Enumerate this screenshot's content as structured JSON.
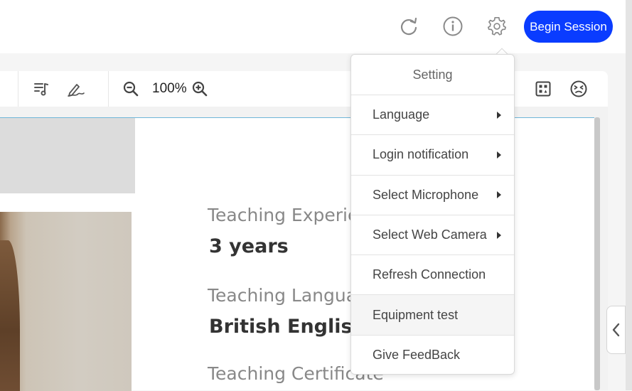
{
  "header": {
    "begin_label": "Begin Session",
    "icons": [
      "refresh-icon",
      "info-icon",
      "gear-icon"
    ]
  },
  "toolbar": {
    "zoom": "100%",
    "icons": [
      "playlist-icon",
      "signature-icon",
      "zoom-out-icon",
      "zoom-in-icon",
      "grid-icon",
      "emoji-icon"
    ]
  },
  "document": {
    "label1": "Teaching Experience",
    "value1": "3 years",
    "label2": "Teaching Language",
    "value2": "British English",
    "label3": "Teaching Certificate"
  },
  "settings_menu": {
    "title": "Setting",
    "items": [
      {
        "label": "Language",
        "submenu": true
      },
      {
        "label": "Login notification",
        "submenu": true
      },
      {
        "label": "Select Microphone",
        "submenu": true
      },
      {
        "label": "Select Web Camera",
        "submenu": true
      },
      {
        "label": "Refresh Connection",
        "submenu": false
      },
      {
        "label": "Equipment test",
        "submenu": false,
        "highlighted": true
      },
      {
        "label": "Give FeedBack",
        "submenu": false
      }
    ]
  },
  "colors": {
    "accent": "#0a3cff",
    "icon": "#8a8a8a"
  }
}
